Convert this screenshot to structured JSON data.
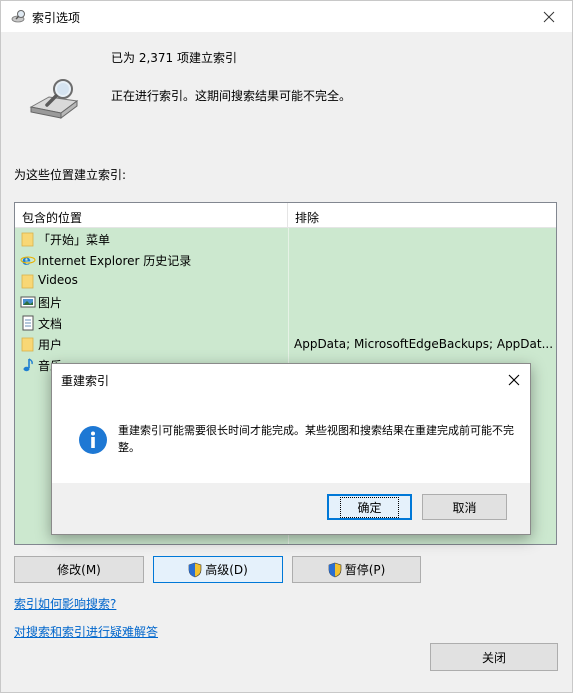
{
  "window": {
    "title": "索引选项",
    "status_count": "已为 2,371 项建立索引",
    "status_progress": "正在进行索引。这期间搜索结果可能不完全。",
    "locations_label": "为这些位置建立索引:"
  },
  "table": {
    "headers": [
      "包含的位置",
      "排除"
    ],
    "rows": [
      {
        "name": "「开始」菜单",
        "exclude": "",
        "icon": "folder-icon"
      },
      {
        "name": "Internet Explorer 历史记录",
        "exclude": "",
        "icon": "internet-explorer-icon"
      },
      {
        "name": "Videos",
        "exclude": "",
        "icon": "folder-icon"
      },
      {
        "name": "图片",
        "exclude": "",
        "icon": "pictures-icon"
      },
      {
        "name": "文档",
        "exclude": "",
        "icon": "documents-icon"
      },
      {
        "name": "用户",
        "exclude": "AppData; MicrosoftEdgeBackups; AppDat...",
        "icon": "folder-icon"
      },
      {
        "name": "音乐",
        "exclude": "",
        "icon": "music-icon"
      }
    ]
  },
  "buttons": {
    "modify": "修改(M)",
    "advanced": "高级(D)",
    "pause": "暂停(P)",
    "close": "关闭"
  },
  "links": {
    "how_affects": "索引如何影响搜索?",
    "troubleshoot": "对搜索和索引进行疑难解答"
  },
  "dialog": {
    "title": "重建索引",
    "message": "重建索引可能需要很长时间才能完成。某些视图和搜索结果在重建完成前可能不完整。",
    "ok": "确定",
    "cancel": "取消"
  }
}
